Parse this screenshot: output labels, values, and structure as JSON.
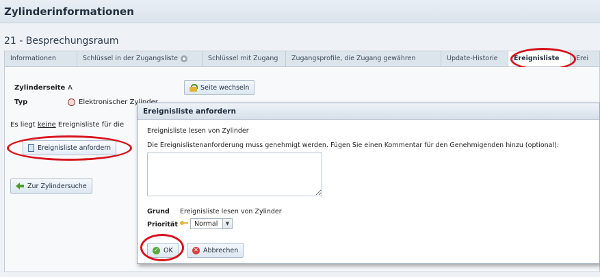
{
  "header": {
    "title": "Zylinderinformationen"
  },
  "cylinder": {
    "name": "21 - Besprechungsraum"
  },
  "tabs": [
    {
      "label": "Informationen"
    },
    {
      "label": "Schlüssel in der Zugangsliste"
    },
    {
      "label": "Schlüssel mit Zugang"
    },
    {
      "label": "Zugangsprofile, die Zugang gewähren"
    },
    {
      "label": "Update-Historie"
    },
    {
      "label": "Ereignisliste"
    },
    {
      "label": "Erei"
    }
  ],
  "details": {
    "side_label": "Zylinderseite",
    "side_value": "A",
    "type_label": "Typ",
    "type_value": "Elektronischer Zylinder",
    "notice_prefix": "Es liegt",
    "notice_underlined": "keine",
    "notice_suffix": "Ereignisliste für die"
  },
  "buttons": {
    "switch_side": "Seite wechseln",
    "request_events": "Ereignisliste anfordern",
    "back_search": "Zur Zylindersuche"
  },
  "modal": {
    "title": "Ereignisliste anfordern",
    "subtitle": "Ereignisliste lesen von Zylinder",
    "instruction": "Die Ereignislistenanforderung muss genehmigt werden. Fügen Sie einen Kommentar für den Genehmigenden hinzu (optional):",
    "comment_value": "",
    "reason_label": "Grund",
    "reason_value": "Ereignisliste lesen von Zylinder",
    "priority_label": "Priorität",
    "priority_value": "Normal",
    "ok_label": "OK",
    "cancel_label": "Abbrechen"
  },
  "colors": {
    "highlight_oval": "#d8121c",
    "accent": "#1f2d3d"
  }
}
